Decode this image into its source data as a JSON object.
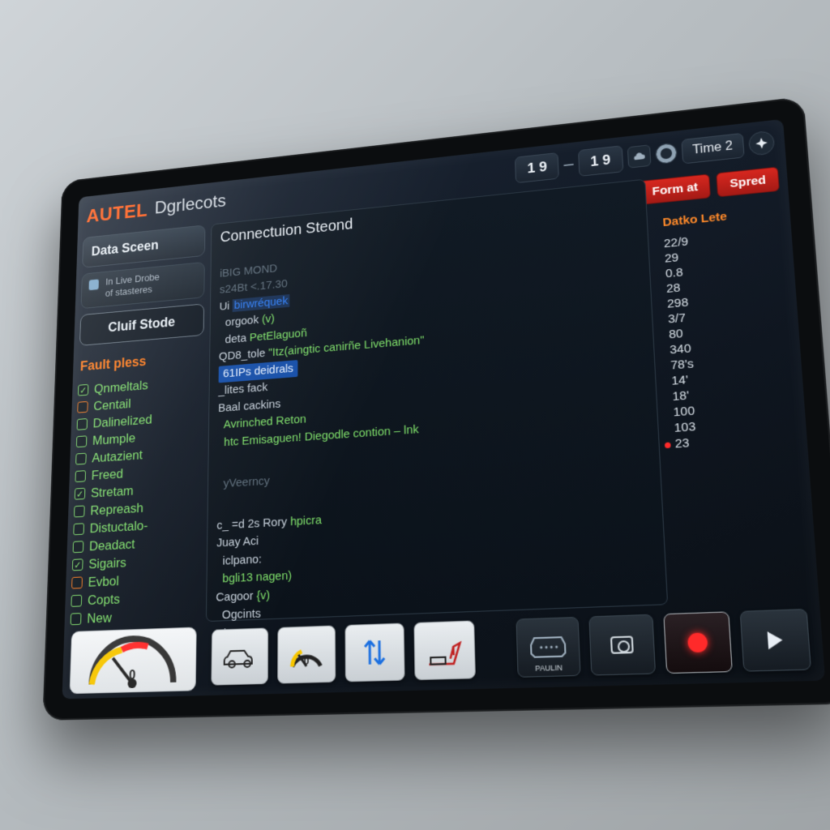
{
  "header": {
    "brand": "AUTEL",
    "app_title": "Dgrlecots",
    "counter_a": "1 9",
    "counter_b": "1 9",
    "time_label": "Time 2"
  },
  "sidebar": {
    "data_screen": "Data Sceen",
    "live_drobe_line1": "In Live Drobe",
    "live_drobe_line2": "of stasteres",
    "cluif_stode": "Cluif Stode",
    "fault_header": "Fault pless",
    "items": [
      {
        "label": "Qnmeltals",
        "checked": true,
        "warn": false
      },
      {
        "label": "Centail",
        "checked": false,
        "warn": true
      },
      {
        "label": "Dalinelized",
        "checked": false,
        "warn": false
      },
      {
        "label": "Mumple",
        "checked": false,
        "warn": false
      },
      {
        "label": "Autazient",
        "checked": false,
        "warn": false
      },
      {
        "label": "Freed",
        "checked": false,
        "warn": false
      },
      {
        "label": "Stretam",
        "checked": true,
        "warn": false
      },
      {
        "label": "Repreash",
        "checked": false,
        "warn": false
      },
      {
        "label": "Distuctalo-",
        "checked": false,
        "warn": false
      },
      {
        "label": "Deadact",
        "checked": false,
        "warn": false
      },
      {
        "label": "Sigairs",
        "checked": true,
        "warn": false
      },
      {
        "label": "Evbol",
        "checked": false,
        "warn": true
      },
      {
        "label": "Copts",
        "checked": false,
        "warn": false
      },
      {
        "label": "New",
        "checked": false,
        "warn": false
      }
    ]
  },
  "main": {
    "title": "Connectuion Steond",
    "lines": {
      "l0": "iBIG MOND",
      "l1": "s24Bt <.17.30",
      "l2_a": "Ui ",
      "l2_b": "birwréquek",
      "l3_a": "  orgook ",
      "l3_b": "(v)",
      "l4_a": "  deta ",
      "l4_b": "PetElaguoñ",
      "l5_a": "QD8_tole ",
      "l5_b": "\"Itz(aingtic canirñe Livehanion\"",
      "l6": "61IPs deidrals",
      "l7": "_lites fack",
      "l8": "Baal cackins",
      "l9": "  Avrinched Reton",
      "l10": "  htc Emisaguen! Diegodle contion – lnk",
      "l11": "  yVeerncy",
      "l12_a": "c_ =d 2s Rory ",
      "l12_b": "hpicra",
      "l13": "Juay Aci",
      "l14": "  iclpano:",
      "l15": "  bgli13 nagen)",
      "l16_a": "Cagoor ",
      "l16_b": "{v)",
      "l17": "  Ogcints",
      "l18": "Hinca"
    }
  },
  "right": {
    "btn_form": "Form at",
    "btn_speed": "Spred",
    "header": "Datko Lete",
    "values": [
      "22/9",
      "29",
      "0.8",
      "28",
      "298",
      "3/7",
      "80",
      "340",
      "78's",
      "14'",
      "18'",
      "100",
      "103",
      "23"
    ],
    "alert_index": 13
  },
  "toolbar": {
    "vehicle": "vehicle",
    "gauge_value": "0",
    "arrows": "arrows",
    "crane": "crane",
    "scan": "scan",
    "snapshot": "snapshot",
    "record": "record",
    "play": "play",
    "paulin": "PAULIN"
  },
  "peek": {
    "value": "0"
  }
}
